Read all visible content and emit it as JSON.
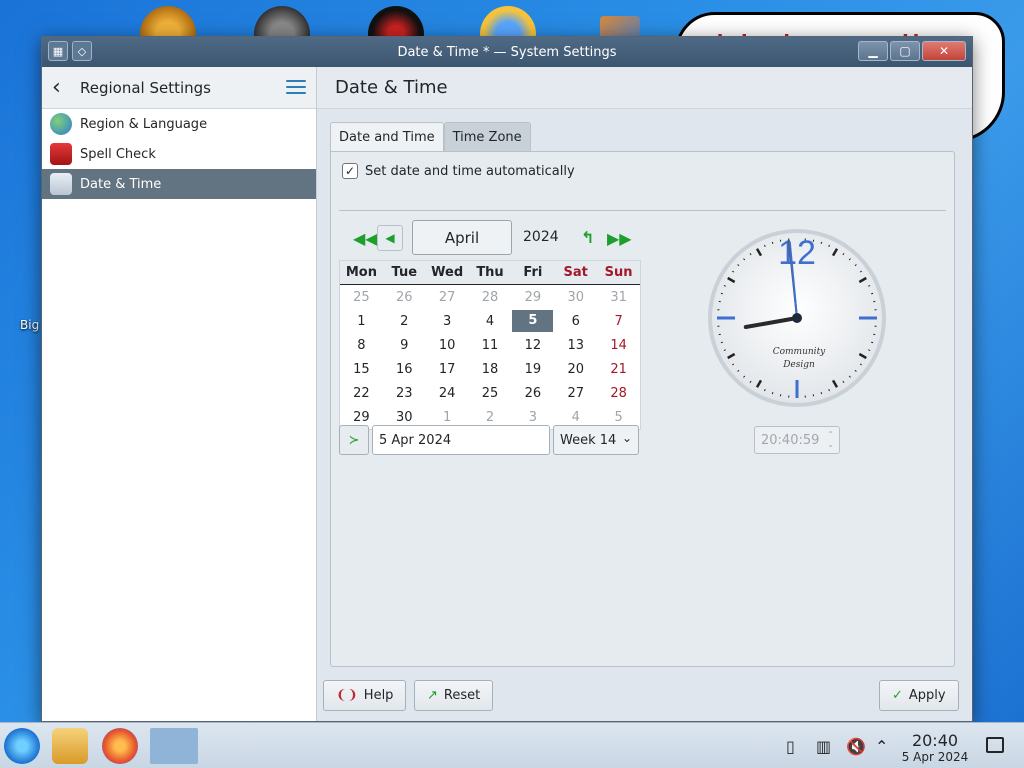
{
  "desktop": {
    "bubble_text": "this is totally",
    "icon_label": "Big"
  },
  "window": {
    "title": "Date & Time * — System Settings"
  },
  "sidebar": {
    "title": "Regional Settings",
    "items": [
      {
        "label": "Region & Language",
        "icon": "globe-icon"
      },
      {
        "label": "Spell Check",
        "icon": "spellcheck-icon"
      },
      {
        "label": "Date & Time",
        "icon": "clock-calendar-icon",
        "active": true
      }
    ]
  },
  "content": {
    "title": "Date & Time",
    "tabs": [
      "Date and Time",
      "Time Zone"
    ],
    "auto_checkbox": {
      "label": "Set date and time automatically",
      "checked": true
    },
    "calendar": {
      "month": "April",
      "year": "2024",
      "weekdays": [
        "Mon",
        "Tue",
        "Wed",
        "Thu",
        "Fri",
        "Sat",
        "Sun"
      ],
      "weeks": [
        [
          "25",
          "26",
          "27",
          "28",
          "29",
          "30",
          "31"
        ],
        [
          "1",
          "2",
          "3",
          "4",
          "5",
          "6",
          "7"
        ],
        [
          "8",
          "9",
          "10",
          "11",
          "12",
          "13",
          "14"
        ],
        [
          "15",
          "16",
          "17",
          "18",
          "19",
          "20",
          "21"
        ],
        [
          "22",
          "23",
          "24",
          "25",
          "26",
          "27",
          "28"
        ],
        [
          "29",
          "30",
          "1",
          "2",
          "3",
          "4",
          "5"
        ]
      ],
      "selected_day": "5",
      "date_value": "5 Apr 2024",
      "week_value": "Week 14"
    },
    "clock": {
      "numeral": "12",
      "brand_line1": "Community",
      "brand_line2": "Design",
      "time_value": "20:40:59",
      "hour": 20,
      "minute": 40,
      "second": 59
    }
  },
  "buttons": {
    "help": "Help",
    "reset": "Reset",
    "apply": "Apply"
  },
  "taskbar": {
    "time": "20:40",
    "date": "5 Apr 2024"
  },
  "colors": {
    "accent": "#627381",
    "weekend": "#a3182a",
    "nav_green": "#1e9e2c",
    "clock_blue": "#3f6fd0"
  }
}
